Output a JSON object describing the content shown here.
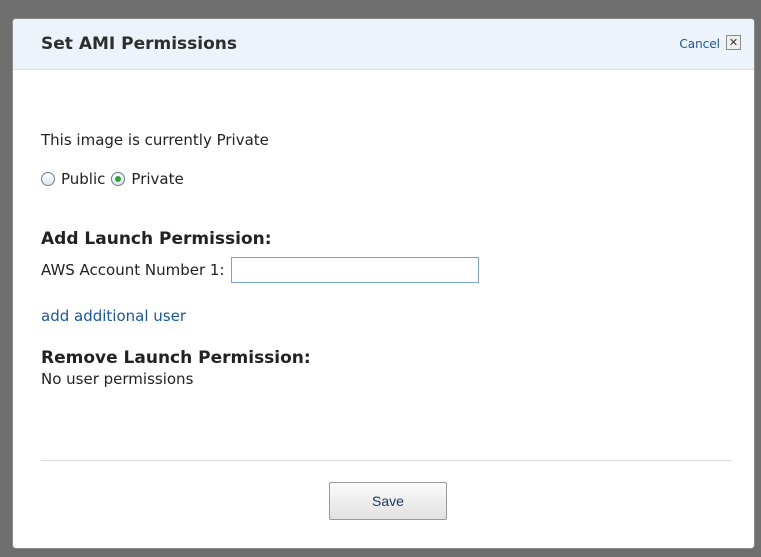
{
  "dialog": {
    "title": "Set AMI Permissions",
    "cancel_label": "Cancel",
    "close_glyph": "✕"
  },
  "status": {
    "text": "This image is currently Private"
  },
  "visibility": {
    "options": [
      {
        "label": "Public",
        "checked": false
      },
      {
        "label": "Private",
        "checked": true
      }
    ]
  },
  "add_permission": {
    "heading": "Add Launch Permission:",
    "account_label": "AWS Account Number 1:",
    "account_value": "",
    "add_user_link": "add additional user"
  },
  "remove_permission": {
    "heading": "Remove Launch Permission:",
    "empty_text": "No user permissions"
  },
  "footer": {
    "save_label": "Save"
  },
  "colors": {
    "link": "#1b57a0",
    "header_bg": "#edf3fa",
    "radio_checked": "#2fa43a"
  }
}
